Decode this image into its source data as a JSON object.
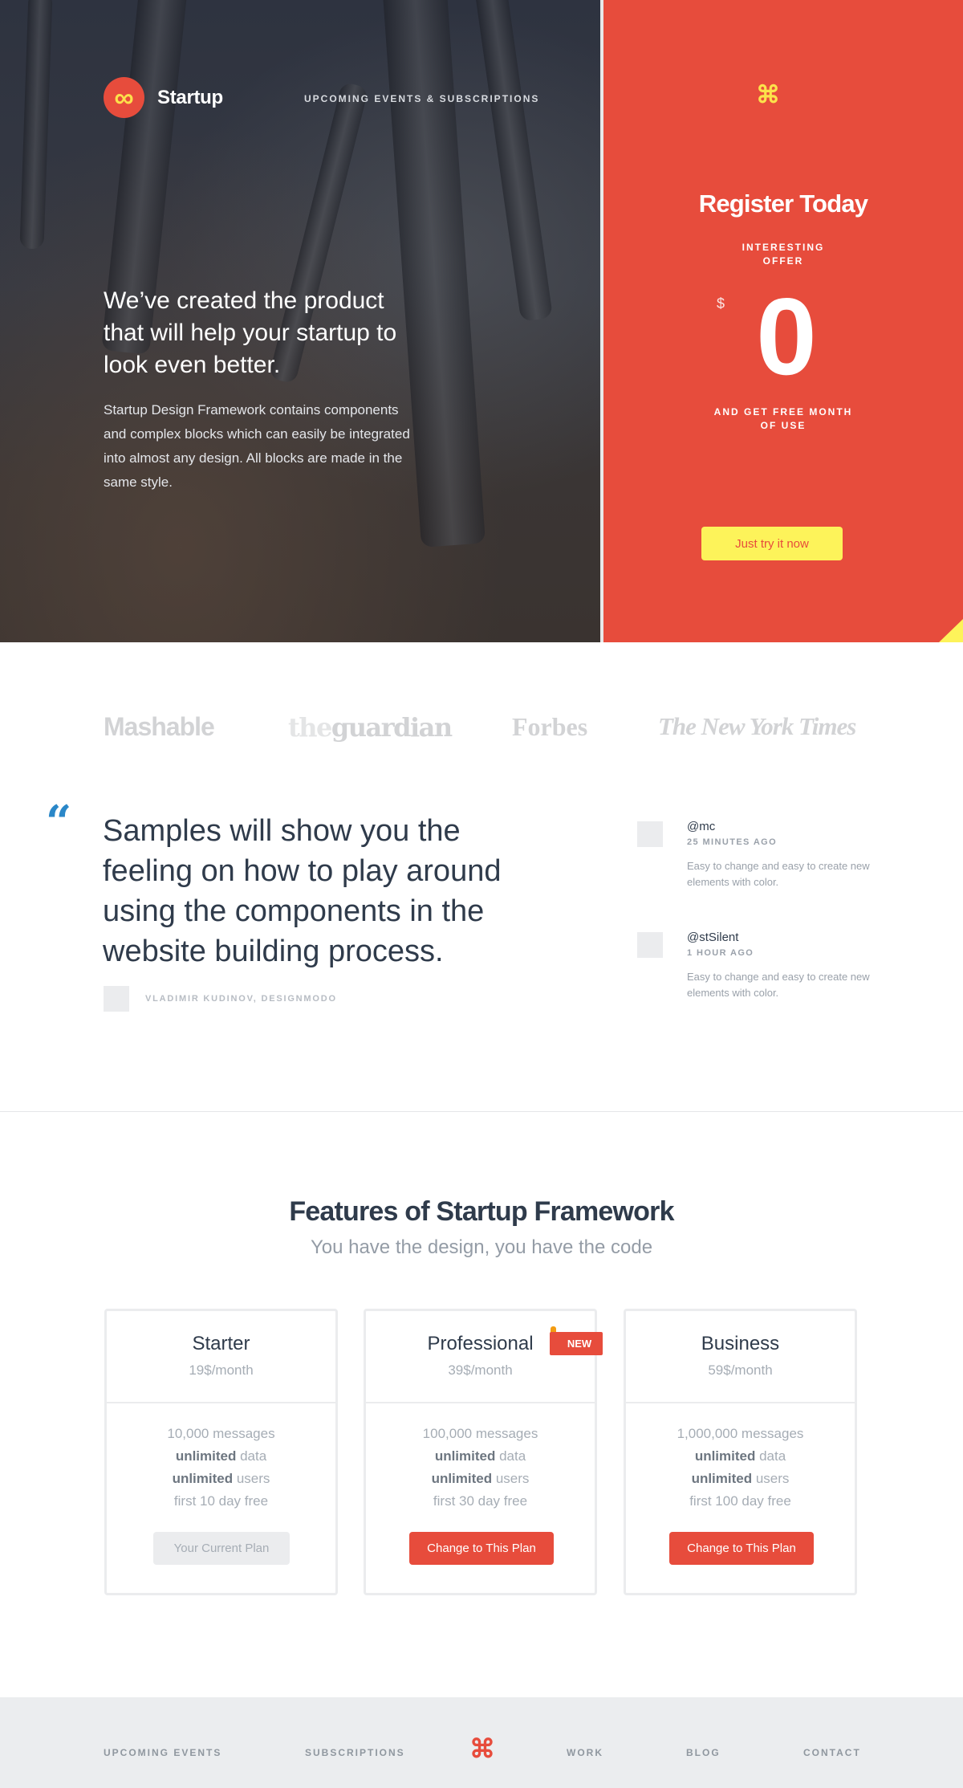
{
  "header": {
    "brand": "Startup",
    "logo_icon": "infinity-icon",
    "nav_label": "UPCOMING EVENTS & SUBSCRIPTIONS",
    "command_icon": "command-icon"
  },
  "hero": {
    "heading": "We’ve created the product that will help your startup to look even better.",
    "text": "Startup Design Framework contains components and complex blocks which can easily be integrated into almost any design. All blocks are made in the same style."
  },
  "register": {
    "title": "Register Today",
    "offer_line1": "INTERESTING",
    "offer_line2": "OFFER",
    "currency": "$",
    "price": "0",
    "free_line1": "AND GET FREE MONTH",
    "free_line2": "OF USE",
    "button": "Just try it now"
  },
  "press": {
    "mashable": "Mashable",
    "guardian_the": "the",
    "guardian_name": "guardian",
    "forbes": "Forbes",
    "nyt": "The New York Times"
  },
  "testimonial": {
    "quote_mark": "“",
    "quote": "Samples will show you the feeling on how to play around using the components in the website building process.",
    "author": "VLADIMIR KUDINOV, DESIGNMODO"
  },
  "tweets": [
    {
      "handle": "@mc",
      "time": "25 MINUTES AGO",
      "body": "Easy to change and easy to create new elements with color."
    },
    {
      "handle": "@stSilent",
      "time": "1 HOUR AGO",
      "body": "Easy to change and easy to create new elements with color."
    }
  ],
  "features": {
    "title": "Features of Startup Framework",
    "subtitle": "You have the design, you have the code",
    "badge": "NEW",
    "plans": [
      {
        "name": "Starter",
        "price": "19$/month",
        "messages": "10,000 messages",
        "data_bold": "unlimited",
        "data_rest": " data",
        "users_bold": "unlimited",
        "users_rest": " users",
        "trial": "first 10 day free",
        "button": "Your Current Plan"
      },
      {
        "name": "Professional",
        "price": "39$/month",
        "messages": "100,000 messages",
        "data_bold": "unlimited",
        "data_rest": " data",
        "users_bold": "unlimited",
        "users_rest": " users",
        "trial": "first 30 day free",
        "button": "Change to This Plan"
      },
      {
        "name": "Business",
        "price": "59$/month",
        "messages": "1,000,000 messages",
        "data_bold": "unlimited",
        "data_rest": " data",
        "users_bold": "unlimited",
        "users_rest": " users",
        "trial": "first 100 day free",
        "button": "Change to This Plan"
      }
    ]
  },
  "footer": {
    "links": [
      "UPCOMING EVENTS",
      "SUBSCRIPTIONS",
      "WORK",
      "BLOG",
      "CONTACT"
    ],
    "command_icon": "command-icon"
  },
  "colors": {
    "accent_red": "#e74c3c",
    "accent_yellow": "#fdf35a",
    "quote_blue": "#2a87c8",
    "text_dark": "#2f3b4b"
  }
}
